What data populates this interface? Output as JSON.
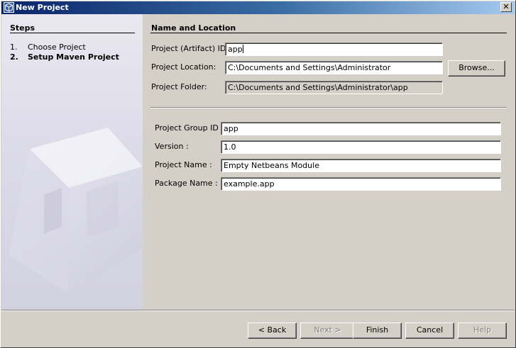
{
  "window": {
    "title": "New Project",
    "close_glyph": "✕"
  },
  "steps": {
    "title": "Steps",
    "items": [
      {
        "num": "1.",
        "label": "Choose Project",
        "current": false
      },
      {
        "num": "2.",
        "label": "Setup Maven Project",
        "current": true
      }
    ]
  },
  "section": {
    "title": "Name and Location"
  },
  "top_fields": {
    "artifact_label": "Project (Artifact) ID:",
    "artifact_value": "app",
    "location_label": "Project Location:",
    "location_value": "C:\\Documents and Settings\\Administrator",
    "browse_label": "Browse...",
    "folder_label": "Project Folder:",
    "folder_value": "C:\\Documents and Settings\\Administrator\\app"
  },
  "maven_fields": {
    "group_label": "Project Group ID :",
    "group_value": "app",
    "version_label": "Version :",
    "version_value": "1.0",
    "name_label": "Project Name :",
    "name_value": "Empty Netbeans Module",
    "package_label": "Package Name :",
    "package_value": "example.app"
  },
  "buttons": {
    "back": "< Back",
    "next": "Next >",
    "finish": "Finish",
    "cancel": "Cancel",
    "help": "Help"
  }
}
